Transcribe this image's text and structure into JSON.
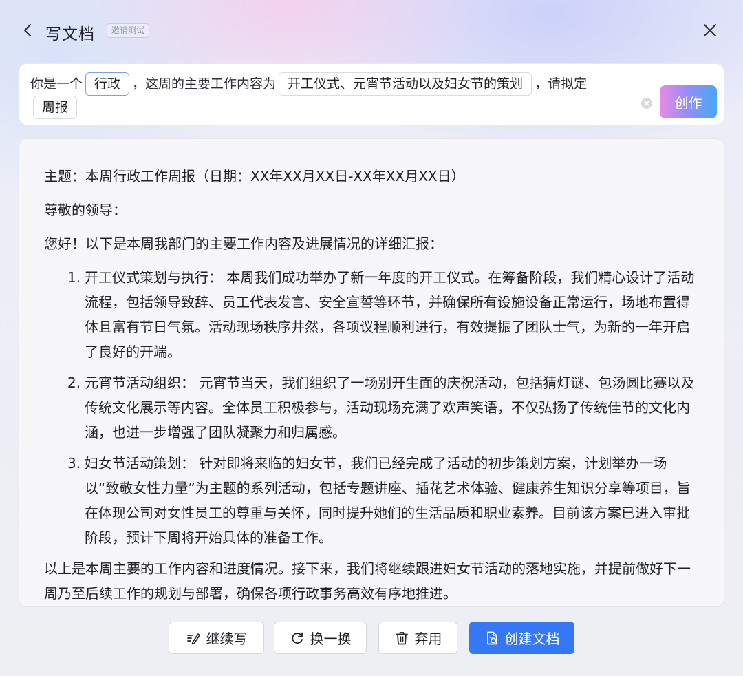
{
  "header": {
    "back_icon": "chevron-left-icon",
    "title": "写文档",
    "badge": "邀请测试",
    "close_icon": "close-icon"
  },
  "prompt": {
    "segment1": "你是一个",
    "role_value": "行政",
    "segment2": "，这周的主要工作内容为",
    "work_value": "开工仪式、元宵节活动以及妇女节的策划",
    "segment3": "，请拟定",
    "doc_type_value": "周报",
    "create_label": "创作",
    "create_gradient": [
      "#e98ae6",
      "#9b8cf5",
      "#45a8f6"
    ]
  },
  "document": {
    "subject": "主题：本周行政工作周报（日期：XX年XX月XX日-XX年XX月XX日）",
    "salutation": "尊敬的领导：",
    "intro": "您好！以下是本周我部门的主要工作内容及进展情况的详细汇报：",
    "items": [
      {
        "num": "1.",
        "text": "开工仪式策划与执行：  本周我们成功举办了新一年度的开工仪式。在筹备阶段，我们精心设计了活动流程，包括领导致辞、员工代表发言、安全宣誓等环节，并确保所有设施设备正常运行，场地布置得体且富有节日气氛。活动现场秩序井然，各项议程顺利进行，有效提振了团队士气，为新的一年开启了良好的开端。"
      },
      {
        "num": "2.",
        "text": "元宵节活动组织：  元宵节当天，我们组织了一场别开生面的庆祝活动，包括猜灯谜、包汤圆比赛以及传统文化展示等内容。全体员工积极参与，活动现场充满了欢声笑语，不仅弘扬了传统佳节的文化内涵，也进一步增强了团队凝聚力和归属感。"
      },
      {
        "num": "3.",
        "text": "妇女节活动策划：  针对即将来临的妇女节，我们已经完成了活动的初步策划方案，计划举办一场以“致敬女性力量”为主题的系列活动，包括专题讲座、插花艺术体验、健康养生知识分享等项目，旨在体现公司对女性员工的尊重与关怀，同时提升她们的生活品质和职业素养。目前该方案已进入审批阶段，预计下周将开始具体的准备工作。"
      }
    ],
    "closing": "以上是本周主要的工作内容和进度情况。接下来，我们将继续跟进妇女节活动的落地实施，并提前做好下一周乃至后续工作的规划与部署，确保各项行政事务高效有序地推进。"
  },
  "footer": {
    "continue_label": "继续写",
    "continue_icon": "pen-icon",
    "refresh_label": "换一换",
    "refresh_icon": "refresh-icon",
    "discard_label": "弃用",
    "discard_icon": "trash-icon",
    "create_doc_label": "创建文档",
    "create_doc_icon": "document-icon",
    "primary_color": "#3478f6"
  }
}
